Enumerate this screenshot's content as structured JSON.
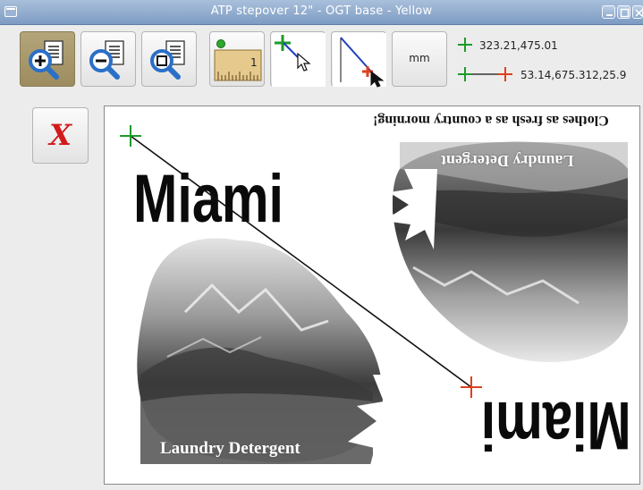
{
  "window": {
    "title": "ATP stepover 12\" - OGT base - Yellow"
  },
  "toolbar": {
    "unit_label": "mm",
    "point_readout": "323.21,475.01",
    "line_readout": "53.14,675.312,25.9"
  },
  "delete_button": {
    "label": "X"
  },
  "artwork": {
    "title_top": "Miami",
    "title_bottom": "Miami",
    "tagline": "Clothes as fresh as a country morning!",
    "product_top": "Laundry Detergent",
    "product_bottom": "Laundry Detergent"
  },
  "colors": {
    "start_marker": "#1e9a2a",
    "end_marker": "#e0401e",
    "delete_x": "#d21a1a",
    "active_button": "#a8996b"
  }
}
